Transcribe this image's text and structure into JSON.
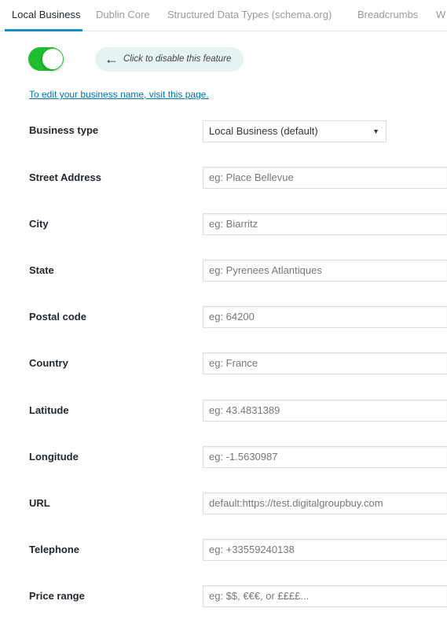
{
  "tabs": [
    {
      "label": "Local Business",
      "active": true
    },
    {
      "label": "Dublin Core"
    },
    {
      "label": "Structured Data Types (schema.org)"
    },
    {
      "label": "Breadcrumbs"
    },
    {
      "label": "W"
    }
  ],
  "toggle": {
    "on": true,
    "color": "#1fbd2f"
  },
  "hint": "Click to disable this feature",
  "edit_link": "To edit your business name, visit this page.",
  "business_type": {
    "label": "Business type",
    "value": "Local Business (default)"
  },
  "fields": [
    {
      "label": "Street Address",
      "placeholder": "eg: Place Bellevue"
    },
    {
      "label": "City",
      "placeholder": "eg: Biarritz"
    },
    {
      "label": "State",
      "placeholder": "eg: Pyrenees Atlantiques"
    },
    {
      "label": "Postal code",
      "placeholder": "eg: 64200"
    },
    {
      "label": "Country",
      "placeholder": "eg: France"
    },
    {
      "label": "Latitude",
      "placeholder": "eg: 43.4831389"
    },
    {
      "label": "Longitude",
      "placeholder": "eg: -1.5630987"
    },
    {
      "label": "URL",
      "placeholder": "default:https://test.digitalgroupbuy.com"
    },
    {
      "label": "Telephone",
      "placeholder": "eg: +33559240138"
    },
    {
      "label": "Price range",
      "placeholder": "eg: $$, €€€, or ££££..."
    }
  ]
}
